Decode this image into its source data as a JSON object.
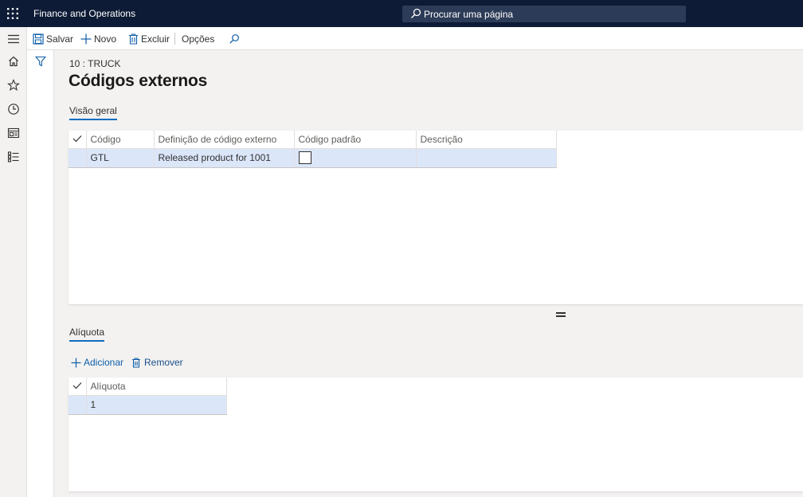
{
  "app": {
    "title": "Finance and Operations",
    "search_placeholder": "Procurar uma página"
  },
  "toolbar": {
    "save_label": "Salvar",
    "new_label": "Novo",
    "delete_label": "Excluir",
    "options_label": "Opções"
  },
  "nav": {
    "items": [
      "menu-icon",
      "home-icon",
      "star-icon",
      "clock-icon",
      "workspace-icon",
      "list-icon"
    ]
  },
  "page": {
    "caption": "10 : TRUCK",
    "title": "Códigos externos",
    "overview_tab": "Visão geral",
    "rate_tab": "Alíquota"
  },
  "overview_grid": {
    "columns": [
      "Código",
      "Definição de código externo",
      "Código padrão",
      "Descrição"
    ],
    "rows": [
      {
        "code": "GTL",
        "definition": "Released product for 1001",
        "default": false,
        "description": ""
      }
    ]
  },
  "rate_actions": {
    "add_label": "Adicionar",
    "remove_label": "Remover"
  },
  "rate_grid": {
    "columns": [
      "Alíquota"
    ],
    "rows": [
      {
        "rate": "1"
      }
    ]
  },
  "colors": {
    "topbar": "#0d1b36",
    "accent": "#0f6cbd",
    "selected_row": "#dbe6f9"
  }
}
